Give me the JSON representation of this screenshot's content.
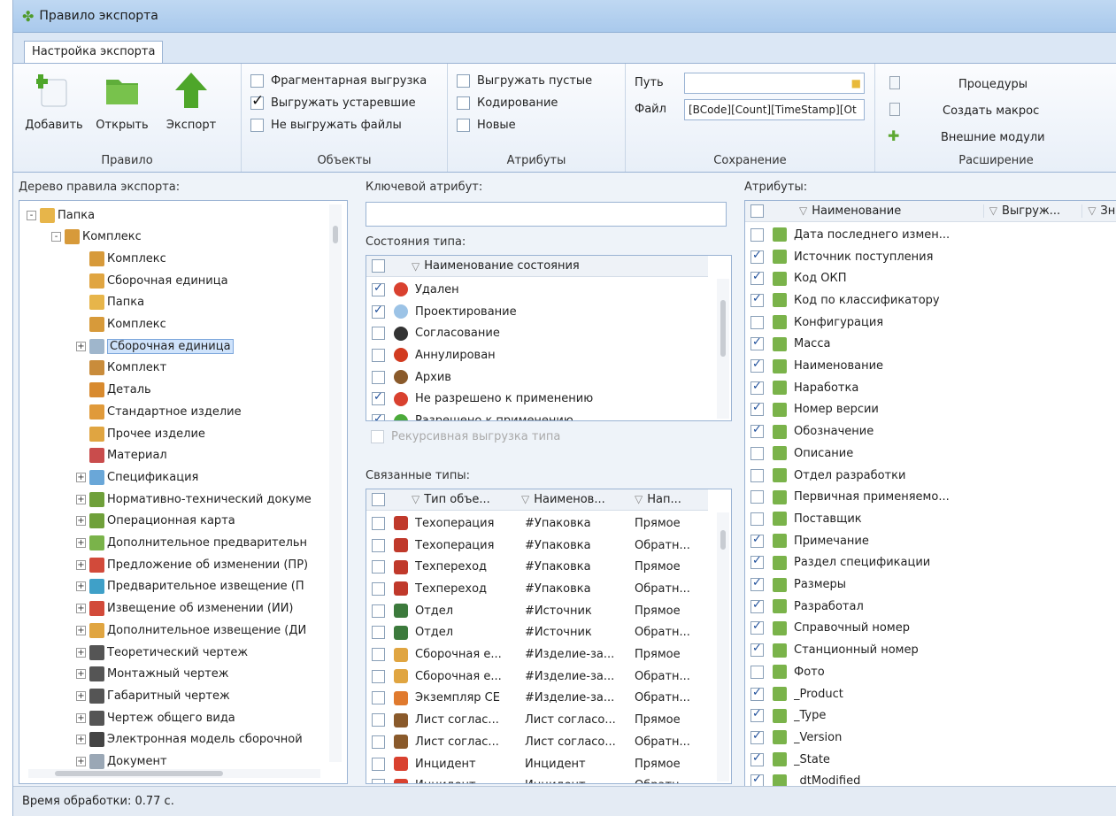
{
  "window": {
    "title": "Правило экспорта"
  },
  "tab": {
    "label": "Настройка экспорта"
  },
  "ribbon": {
    "rule": {
      "group": "Правило",
      "add": "Добавить",
      "open": "Открыть",
      "export": "Экспорт"
    },
    "objects": {
      "group": "Объекты",
      "items": [
        {
          "label": "Фрагментарная выгрузка",
          "checked": false
        },
        {
          "label": "Выгружать устаревшие",
          "checked": true
        },
        {
          "label": "Не выгружать файлы",
          "checked": false
        }
      ]
    },
    "attributes": {
      "group": "Атрибуты",
      "items": [
        {
          "label": "Выгружать пустые",
          "checked": false
        },
        {
          "label": "Кодирование",
          "checked": false
        },
        {
          "label": "Новые",
          "checked": false
        }
      ]
    },
    "save": {
      "group": "Сохранение",
      "path_label": "Путь",
      "path_value": "",
      "file_label": "Файл",
      "file_value": "[BCode][Count][TimeStamp][Ot"
    },
    "ext": {
      "group": "Расширение",
      "procedures": "Процедуры",
      "create_macro": "Создать макрос",
      "modules": "Внешние модули"
    }
  },
  "tree": {
    "label": "Дерево правила экспорта:",
    "items": [
      {
        "text": "Папка",
        "level": 0,
        "exp": "-",
        "icon": "folder-icon",
        "color": "#e7b54a"
      },
      {
        "text": "Комплекс",
        "level": 1,
        "exp": "-",
        "icon": "complex-icon",
        "color": "#d79a3a"
      },
      {
        "text": "Комплекс",
        "level": 2,
        "exp": "",
        "icon": "complex-icon",
        "color": "#d79a3a"
      },
      {
        "text": "Сборочная единица",
        "level": 2,
        "exp": "",
        "icon": "assembly-icon",
        "color": "#e0a541"
      },
      {
        "text": "Папка",
        "level": 2,
        "exp": "",
        "icon": "folder-icon",
        "color": "#e7b54a"
      },
      {
        "text": "Комплекс",
        "level": 2,
        "exp": "",
        "icon": "complex-icon",
        "color": "#d79a3a"
      },
      {
        "text": "Сборочная единица",
        "level": 2,
        "exp": "+",
        "icon": "assembly-icon",
        "color": "#9fb6cc",
        "selected": true
      },
      {
        "text": "Комплект",
        "level": 2,
        "exp": "",
        "icon": "kit-icon",
        "color": "#c98c3b"
      },
      {
        "text": "Деталь",
        "level": 2,
        "exp": "",
        "icon": "part-icon",
        "color": "#d88a2e"
      },
      {
        "text": "Стандартное изделие",
        "level": 2,
        "exp": "",
        "icon": "standard-part-icon",
        "color": "#e09a3a"
      },
      {
        "text": "Прочее изделие",
        "level": 2,
        "exp": "",
        "icon": "other-part-icon",
        "color": "#e0a541"
      },
      {
        "text": "Материал",
        "level": 2,
        "exp": "",
        "icon": "material-icon",
        "color": "#c94c4c"
      },
      {
        "text": "Спецификация",
        "level": 2,
        "exp": "+",
        "icon": "spec-icon",
        "color": "#6aa7d8"
      },
      {
        "text": "Нормативно-технический докуме",
        "level": 2,
        "exp": "+",
        "icon": "normdoc-icon",
        "color": "#6fa03a"
      },
      {
        "text": "Операционная карта",
        "level": 2,
        "exp": "+",
        "icon": "opcard-icon",
        "color": "#6fa03a"
      },
      {
        "text": "Дополнительное предварительн",
        "level": 2,
        "exp": "+",
        "icon": "notice-icon",
        "color": "#7ab34a"
      },
      {
        "text": "Предложение об изменении (ПР)",
        "level": 2,
        "exp": "+",
        "icon": "notice-icon",
        "color": "#d24a3a"
      },
      {
        "text": "Предварительное извещение (П",
        "level": 2,
        "exp": "+",
        "icon": "notice-icon",
        "color": "#3fa0c8"
      },
      {
        "text": "Извещение об изменении (ИИ)",
        "level": 2,
        "exp": "+",
        "icon": "notice-icon",
        "color": "#d24a3a"
      },
      {
        "text": "Дополнительное извещение (ДИ",
        "level": 2,
        "exp": "+",
        "icon": "notice-icon",
        "color": "#e0a541"
      },
      {
        "text": "Теоретический чертеж",
        "level": 2,
        "exp": "+",
        "icon": "drawing-icon",
        "color": "#555"
      },
      {
        "text": "Монтажный чертеж",
        "level": 2,
        "exp": "+",
        "icon": "drawing-icon",
        "color": "#555"
      },
      {
        "text": "Габаритный чертеж",
        "level": 2,
        "exp": "+",
        "icon": "drawing-icon",
        "color": "#555"
      },
      {
        "text": "Чертеж общего вида",
        "level": 2,
        "exp": "+",
        "icon": "drawing-icon",
        "color": "#555"
      },
      {
        "text": "Электронная модель сборочной",
        "level": 2,
        "exp": "+",
        "icon": "model-icon",
        "color": "#444"
      },
      {
        "text": "Документ",
        "level": 2,
        "exp": "+",
        "icon": "document-icon",
        "color": "#9aa7b5"
      }
    ]
  },
  "key_attr": {
    "label": "Ключевой атрибут:",
    "value": ""
  },
  "states": {
    "label": "Состояния типа:",
    "header": "Наименование состояния",
    "rows": [
      {
        "text": "Удален",
        "checked": true,
        "icon": "deleted-icon",
        "color": "#d9412f"
      },
      {
        "text": "Проектирование",
        "checked": true,
        "icon": "design-icon",
        "color": "#9cc3e6"
      },
      {
        "text": "Согласование",
        "checked": false,
        "icon": "approval-icon",
        "color": "#333"
      },
      {
        "text": "Аннулирован",
        "checked": false,
        "icon": "cancelled-icon",
        "color": "#d23b20"
      },
      {
        "text": "Архив",
        "checked": false,
        "icon": "archive-icon",
        "color": "#8a5a2b"
      },
      {
        "text": "Не разрешено к применению",
        "checked": true,
        "icon": "forbidden-icon",
        "color": "#d9412f"
      },
      {
        "text": "Разрешено к применению",
        "checked": true,
        "icon": "allowed-icon",
        "color": "#4caa3a"
      }
    ],
    "recursive": "Рекурсивная выгрузка типа"
  },
  "linked": {
    "label": "Связанные типы:",
    "headers": [
      "Тип объе...",
      "Наименов...",
      "Нап..."
    ],
    "rows": [
      [
        "Техоперация",
        "#Упаковка",
        "Прямое",
        "techop-icon",
        "#c0392b"
      ],
      [
        "Техоперация",
        "#Упаковка",
        "Обратн...",
        "techop-icon",
        "#c0392b"
      ],
      [
        "Техпереход",
        "#Упаковка",
        "Прямое",
        "techstep-icon",
        "#c0392b"
      ],
      [
        "Техпереход",
        "#Упаковка",
        "Обратн...",
        "techstep-icon",
        "#c0392b"
      ],
      [
        "Отдел",
        "#Источник",
        "Прямое",
        "department-icon",
        "#3c7a3c"
      ],
      [
        "Отдел",
        "#Источник",
        "Обратн...",
        "department-icon",
        "#3c7a3c"
      ],
      [
        "Сборочная е...",
        "#Изделие-за...",
        "Прямое",
        "assembly-icon",
        "#e0a541"
      ],
      [
        "Сборочная е...",
        "#Изделие-за...",
        "Обратн...",
        "assembly-icon",
        "#e0a541"
      ],
      [
        "Экземпляр СЕ",
        "#Изделие-за...",
        "Обратн...",
        "instance-icon",
        "#e07a2e"
      ],
      [
        "Лист соглас...",
        "Лист согласо...",
        "Прямое",
        "approval-sheet-icon",
        "#8a5a2b"
      ],
      [
        "Лист соглас...",
        "Лист согласо...",
        "Обратн...",
        "approval-sheet-icon",
        "#8a5a2b"
      ],
      [
        "Инцидент",
        "Инцидент",
        "Прямое",
        "incident-icon",
        "#d9412f"
      ],
      [
        "Инцидент",
        "Инцидент",
        "Обратн...",
        "incident-icon",
        "#d9412f"
      ]
    ]
  },
  "attrs": {
    "label": "Атрибуты:",
    "headers": [
      "Наименование",
      "Выгруж...",
      "Зна"
    ],
    "rows": [
      {
        "text": "Дата последнего измен...",
        "checked": false
      },
      {
        "text": "Источник поступления",
        "checked": true
      },
      {
        "text": "Код ОКП",
        "checked": true
      },
      {
        "text": "Код по классификатору",
        "checked": true
      },
      {
        "text": "Конфигурация",
        "checked": false
      },
      {
        "text": "Масса",
        "checked": true
      },
      {
        "text": "Наименование",
        "checked": true
      },
      {
        "text": "Наработка",
        "checked": true
      },
      {
        "text": "Номер версии",
        "checked": true
      },
      {
        "text": "Обозначение",
        "checked": true
      },
      {
        "text": "Описание",
        "checked": false
      },
      {
        "text": "Отдел разработки",
        "checked": false
      },
      {
        "text": "Первичная применяемо...",
        "checked": false
      },
      {
        "text": "Поставщик",
        "checked": false
      },
      {
        "text": "Примечание",
        "checked": true
      },
      {
        "text": "Раздел спецификации",
        "checked": true
      },
      {
        "text": "Размеры",
        "checked": true
      },
      {
        "text": "Разработал",
        "checked": true
      },
      {
        "text": "Справочный номер",
        "checked": true
      },
      {
        "text": "Станционный номер",
        "checked": true
      },
      {
        "text": "Фото",
        "checked": false
      },
      {
        "text": "_Product",
        "checked": true
      },
      {
        "text": "_Type",
        "checked": true
      },
      {
        "text": "_Version",
        "checked": true
      },
      {
        "text": "_State",
        "checked": true
      },
      {
        "text": "_dtModified",
        "checked": true
      }
    ]
  },
  "status": {
    "text": "Время обработки: 0.77 с."
  }
}
